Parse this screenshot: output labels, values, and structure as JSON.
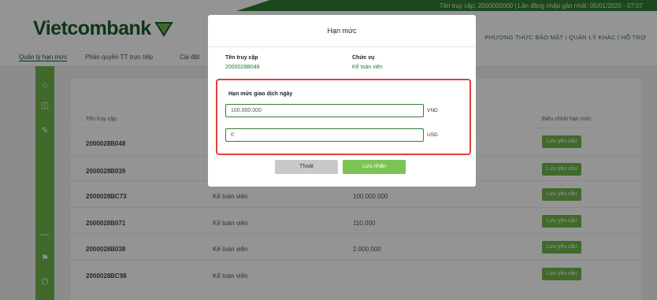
{
  "header": {
    "logo_text": "Vietcombank",
    "top_info": "Tên truy cập: 2000000000 | Lần đăng nhập gần nhất: 05/01/2020 - 07:07",
    "nav": "PHƯƠNG THỨC BẢO MẬT | QUẢN LÝ KHÁC | HỖ TRỢ"
  },
  "subnav": {
    "active": "Quản lý hạn mức",
    "item2": "Phân quyền TT trực tiếp",
    "item3": "Cài đặt"
  },
  "table": {
    "headers": [
      "Tên truy cập",
      "",
      "",
      "Điều chỉnh hạn mức"
    ],
    "rows": [
      {
        "user": "2000028B048",
        "role": "",
        "limit": "",
        "action": "Lưu yêu cầu"
      },
      {
        "user": "2000028B039",
        "role": "",
        "limit": "",
        "action": "Lưu yêu cầu"
      },
      {
        "user": "2000028BC73",
        "role": "Kế toán viên",
        "limit": "100.000.000",
        "action": "Lưu yêu cầu"
      },
      {
        "user": "2000028B071",
        "role": "Kế toán viên",
        "limit": "110.000",
        "action": "Lưu yêu cầu"
      },
      {
        "user": "2000028B038",
        "role": "Kế toán viên",
        "limit": "2.000.000",
        "action": "Lưu yêu cầu"
      },
      {
        "user": "2000028BC98",
        "role": "Kế toán viên",
        "limit": "",
        "action": "Lưu yêu cầu"
      }
    ]
  },
  "modal": {
    "title": "Hạn mức",
    "username_label": "Tên truy cập",
    "username_value": "2000028B048",
    "role_label": "Chức vụ",
    "role_value": "Kế toán viên",
    "limit_label": "Hạn mức giao dịch ngày",
    "vnd_value": "100.000.000",
    "vnd_unit": "VND",
    "usd_value": "0",
    "usd_unit": "USD",
    "cancel_label": "Thoát",
    "save_label": "Lưu nhận"
  },
  "colors": {
    "brand_green": "#2f7d32",
    "accent_green": "#6eb54a",
    "highlight_red": "#e0413b"
  }
}
